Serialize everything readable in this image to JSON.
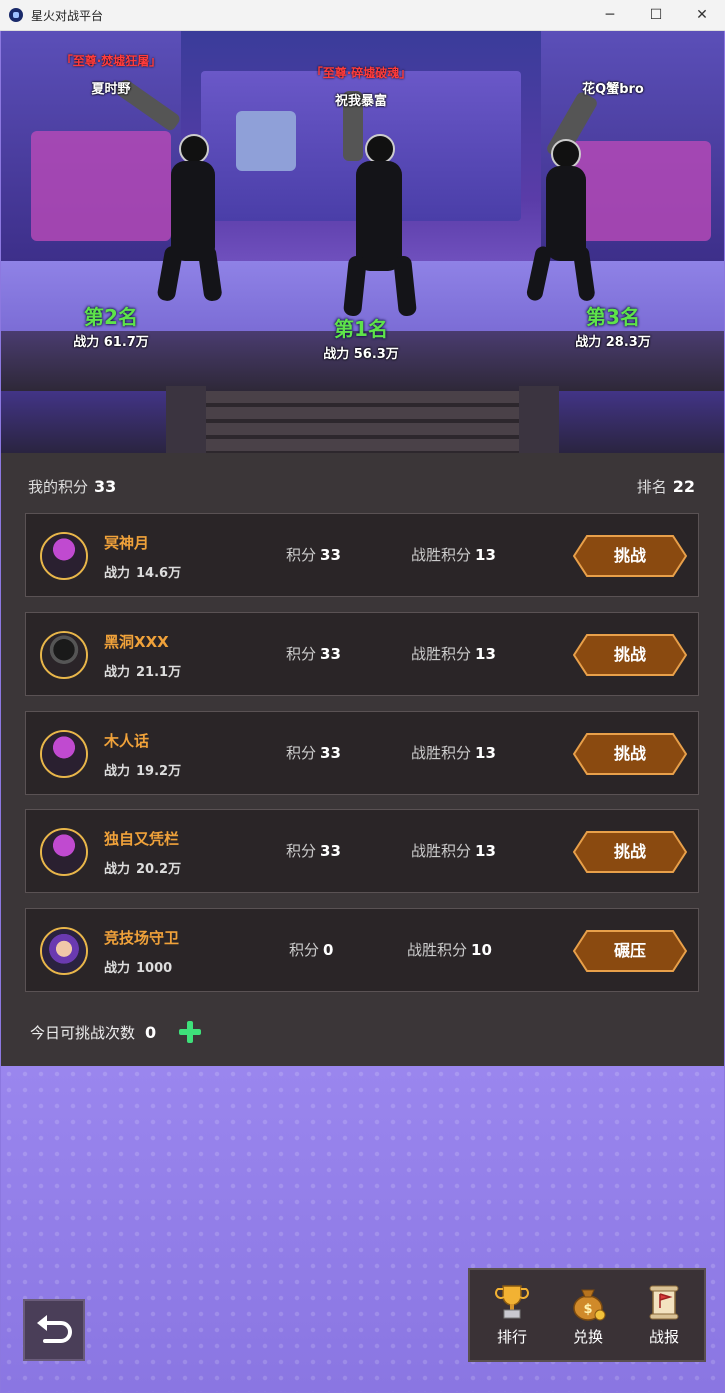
{
  "window": {
    "title": "星火对战平台",
    "minimize": "─",
    "maximize": "☐",
    "close": "✕"
  },
  "podium": [
    {
      "position": "left",
      "title": "「至尊·焚墟狂屠」",
      "name": "夏时野",
      "rank": "第2名",
      "power_label": "战力",
      "power": "61.7万"
    },
    {
      "position": "center",
      "title": "「至尊·碎墟破魂」",
      "name": "祝我暴富",
      "rank": "第1名",
      "power_label": "战力",
      "power": "56.3万"
    },
    {
      "position": "right",
      "title": "",
      "name": "花Q蟹bro",
      "rank": "第3名",
      "power_label": "战力",
      "power": "28.3万"
    }
  ],
  "summary": {
    "my_score_label": "我的积分",
    "my_score": "33",
    "rank_label": "排名",
    "rank": "22"
  },
  "opponents": [
    {
      "name": "冥神月",
      "power_label": "战力",
      "power": "14.6万",
      "score_label": "积分",
      "score": "33",
      "win_label": "战胜积分",
      "win": "13",
      "action": "挑战",
      "avatar": "purple-hair-avatar"
    },
    {
      "name": "黑洞XXX",
      "power_label": "战力",
      "power": "21.1万",
      "score_label": "积分",
      "score": "33",
      "win_label": "战胜积分",
      "win": "13",
      "action": "挑战",
      "avatar": "masked-avatar"
    },
    {
      "name": "木人话",
      "power_label": "战力",
      "power": "19.2万",
      "score_label": "积分",
      "score": "33",
      "win_label": "战胜积分",
      "win": "13",
      "action": "挑战",
      "avatar": "purple-hair-avatar"
    },
    {
      "name": "独自又凭栏",
      "power_label": "战力",
      "power": "20.2万",
      "score_label": "积分",
      "score": "33",
      "win_label": "战胜积分",
      "win": "13",
      "action": "挑战",
      "avatar": "purple-hair-avatar"
    },
    {
      "name": "竞技场守卫",
      "power_label": "战力",
      "power": "1000",
      "score_label": "积分",
      "score": "0",
      "win_label": "战胜积分",
      "win": "10",
      "action": "碾压",
      "avatar": "cat-ear-avatar"
    }
  ],
  "daily": {
    "label": "今日可挑战次数",
    "count": "0"
  },
  "nav": [
    {
      "label": "排行",
      "icon": "trophy-icon"
    },
    {
      "label": "兑换",
      "icon": "money-bag-icon"
    },
    {
      "label": "战报",
      "icon": "scroll-icon"
    }
  ],
  "colors": {
    "accent_orange": "#f0a23a",
    "button_brown": "#8a4a10",
    "rank_green": "#5ee34a",
    "title_red": "#ff3b3b"
  }
}
